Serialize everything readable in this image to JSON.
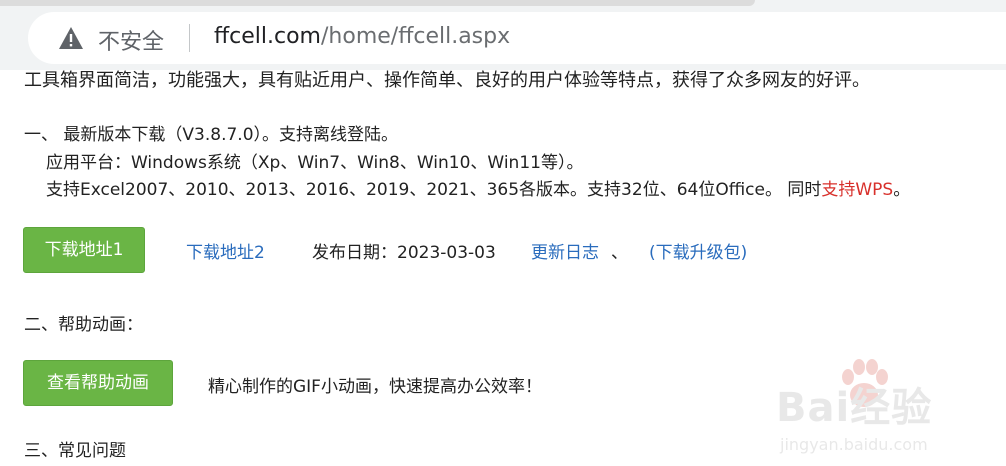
{
  "browser": {
    "security_label": "不安全",
    "url_host": "ffcell.com",
    "url_path": "/home/ffcell.aspx"
  },
  "content": {
    "intro_partial": "工具箱界面简洁，功能强大，具有贴近用户、操作简单、良好的用户体验等特点，获得了众多网友的好评。",
    "section1": {
      "heading": "一、 最新版本下载（V3.8.7.0）。支持离线登陆。",
      "platform": "应用平台：Windows系统（Xp、Win7、Win8、Win10、Win11等）。",
      "support_prefix": "支持Excel2007、2010、2013、2016、2019、2021、365各版本。支持32位、64位Office。 同时",
      "support_wps": "支持WPS",
      "support_suffix": "。",
      "download_button": "下载地址1",
      "download_link2": "下载地址2",
      "release_date": "发布日期：2023-03-03",
      "changelog_link": "更新日志",
      "changelog_sep": "、",
      "upgrade_link": "(下载升级包)"
    },
    "section2": {
      "heading": "二、帮助动画：",
      "help_button": "查看帮助动画",
      "help_desc": "精心制作的GIF小动画，快速提高办公效率！"
    },
    "section3": {
      "heading": "三、常见问题"
    }
  },
  "watermark": {
    "brand": "Bai经验",
    "sub": "jingyan.baidu.com"
  },
  "colors": {
    "button_green": "#6ab545",
    "link_blue": "#2a6cbd",
    "wps_red": "#d8302b"
  }
}
